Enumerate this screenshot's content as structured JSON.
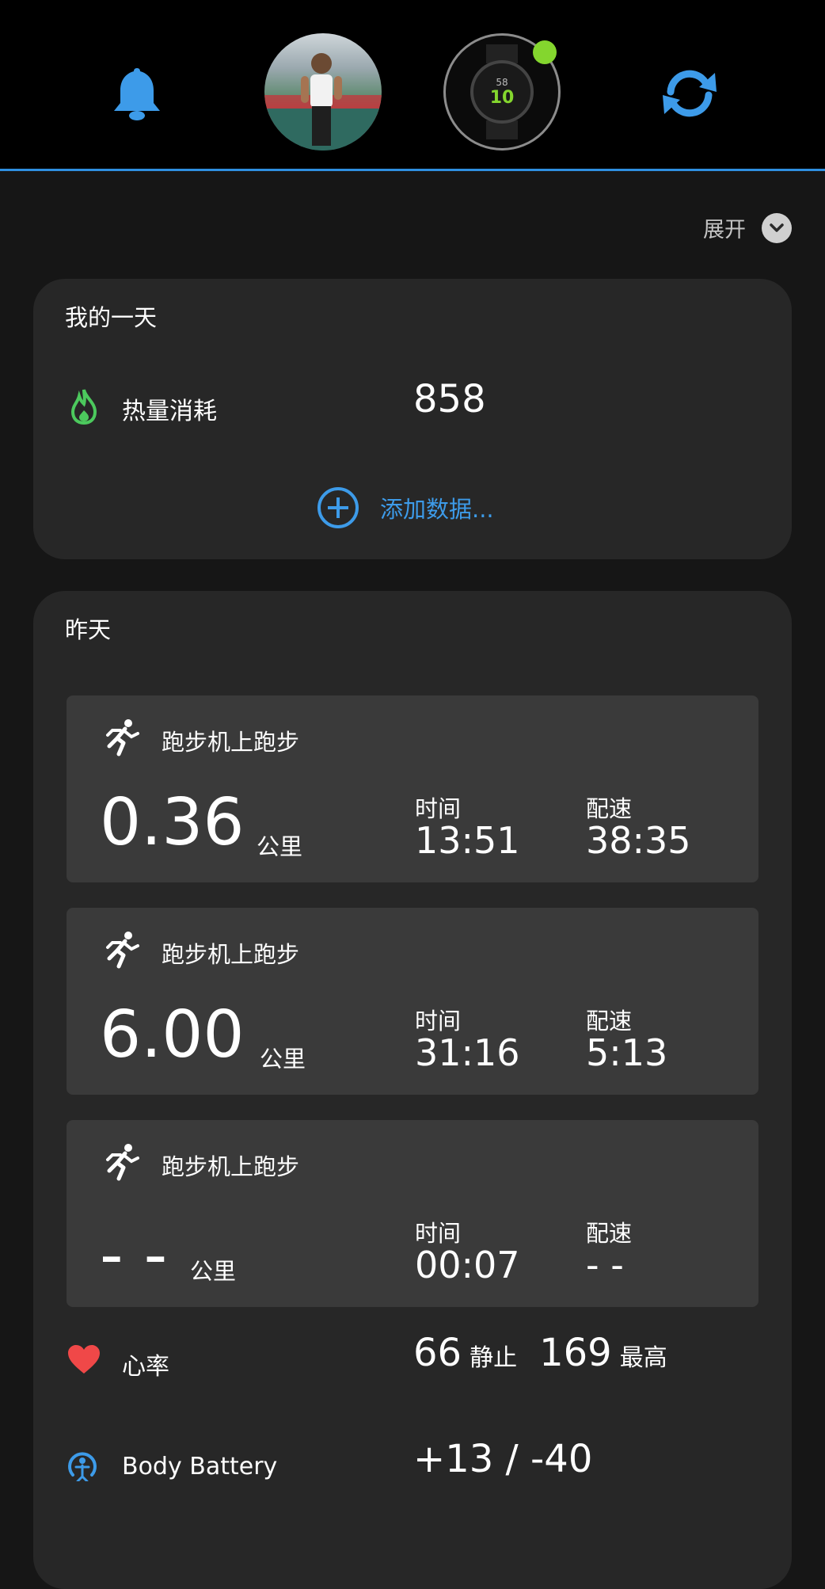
{
  "header": {
    "avatar_label": "profile photo",
    "device_label": "watch",
    "device_status_color": "#84d62e",
    "accent": "#2f8fe0"
  },
  "expand": {
    "label": "展开"
  },
  "my_day": {
    "title": "我的一天",
    "calories": {
      "label": "热量消耗",
      "value": "858"
    },
    "add_data": "添加数据..."
  },
  "yesterday": {
    "title": "昨天",
    "activities": [
      {
        "name": "跑步机上跑步",
        "distance": "0.36",
        "unit": "公里",
        "time_label": "时间",
        "time": "13:51",
        "pace_label": "配速",
        "pace": "38:35"
      },
      {
        "name": "跑步机上跑步",
        "distance": "6.00",
        "unit": "公里",
        "time_label": "时间",
        "time": "31:16",
        "pace_label": "配速",
        "pace": "5:13"
      },
      {
        "name": "跑步机上跑步",
        "distance": "- -",
        "unit": "公里",
        "time_label": "时间",
        "time": "00:07",
        "pace_label": "配速",
        "pace": "- -"
      }
    ],
    "heart_rate": {
      "label": "心率",
      "resting": "66",
      "resting_label": "静止",
      "max": "169",
      "max_label": "最高"
    },
    "body_battery": {
      "label": "Body Battery",
      "value": "+13 / -40"
    }
  }
}
